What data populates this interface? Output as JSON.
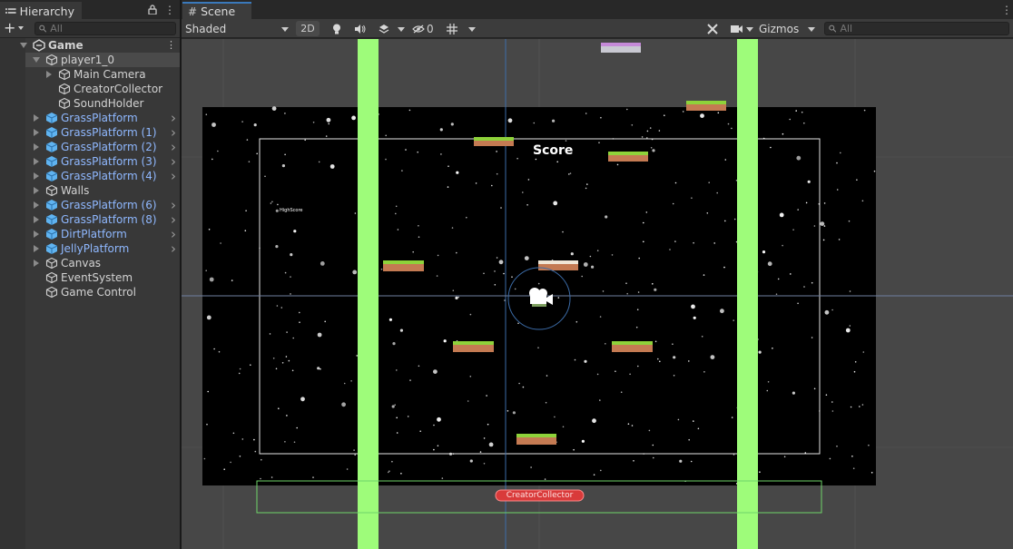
{
  "hierarchy": {
    "tab_title": "Hierarchy",
    "search_placeholder": "All",
    "items": [
      {
        "label": "Game",
        "depth": 0,
        "expanded": true,
        "prefab": false,
        "scene": true
      },
      {
        "label": "player1_0",
        "depth": 1,
        "expanded": true,
        "prefab": false,
        "selected": true
      },
      {
        "label": "Main Camera",
        "depth": 2,
        "expandable": true,
        "prefab": false
      },
      {
        "label": "CreatorCollector",
        "depth": 2,
        "prefab": false
      },
      {
        "label": "SoundHolder",
        "depth": 2,
        "prefab": false
      },
      {
        "label": "GrassPlatform",
        "depth": 1,
        "expandable": true,
        "prefab": true
      },
      {
        "label": "GrassPlatform (1)",
        "depth": 1,
        "expandable": true,
        "prefab": true
      },
      {
        "label": "GrassPlatform (2)",
        "depth": 1,
        "expandable": true,
        "prefab": true
      },
      {
        "label": "GrassPlatform (3)",
        "depth": 1,
        "expandable": true,
        "prefab": true
      },
      {
        "label": "GrassPlatform (4)",
        "depth": 1,
        "expandable": true,
        "prefab": true
      },
      {
        "label": "Walls",
        "depth": 1,
        "expandable": true,
        "prefab": false
      },
      {
        "label": "GrassPlatform (6)",
        "depth": 1,
        "expandable": true,
        "prefab": true
      },
      {
        "label": "GrassPlatform (8)",
        "depth": 1,
        "expandable": true,
        "prefab": true
      },
      {
        "label": "DirtPlatform",
        "depth": 1,
        "expandable": true,
        "prefab": true
      },
      {
        "label": "JellyPlatform",
        "depth": 1,
        "expandable": true,
        "prefab": true
      },
      {
        "label": "Canvas",
        "depth": 1,
        "expandable": true,
        "prefab": false
      },
      {
        "label": "EventSystem",
        "depth": 1,
        "prefab": false
      },
      {
        "label": "Game Control",
        "depth": 1,
        "prefab": false
      }
    ]
  },
  "scene": {
    "tab_title": "Scene",
    "shading_mode": "Shaded",
    "btn_2d": "2D",
    "hidden_count": "0",
    "gizmos_label": "Gizmos",
    "search_placeholder": "All",
    "score_text": "Score",
    "highscore_text": "HighScore",
    "collector_label": "CreatorCollector"
  },
  "colors": {
    "accent": "#3a79bb",
    "prefab_text": "#8fb8ff",
    "wall": "#9efc7a",
    "collector": "#d93a3a",
    "grass_top": "#8ed23a",
    "dirt": "#c47a52",
    "jelly": "#c58ad8"
  }
}
